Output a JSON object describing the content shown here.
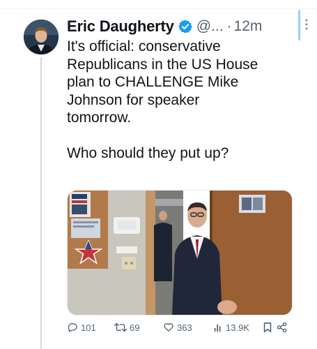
{
  "tweet": {
    "author_name": "Eric Daugherty",
    "handle": "@...",
    "separator": "·",
    "time": "12m",
    "more_icon": "ellipsis-vertical-icon",
    "verified_color": "#1d9bf0",
    "text": "It's official: conservative\nRepublicans in the US House\nplan to CHALLENGE Mike\nJohnson for speaker\ntomorrow.\n\nWho should they put up?"
  },
  "actions": {
    "replies": "101",
    "retweets": "69",
    "likes": "363",
    "views": "13.9K"
  },
  "icons": [
    "reply-icon",
    "retweet-icon",
    "like-icon",
    "views-icon",
    "bookmark-icon",
    "share-icon"
  ]
}
